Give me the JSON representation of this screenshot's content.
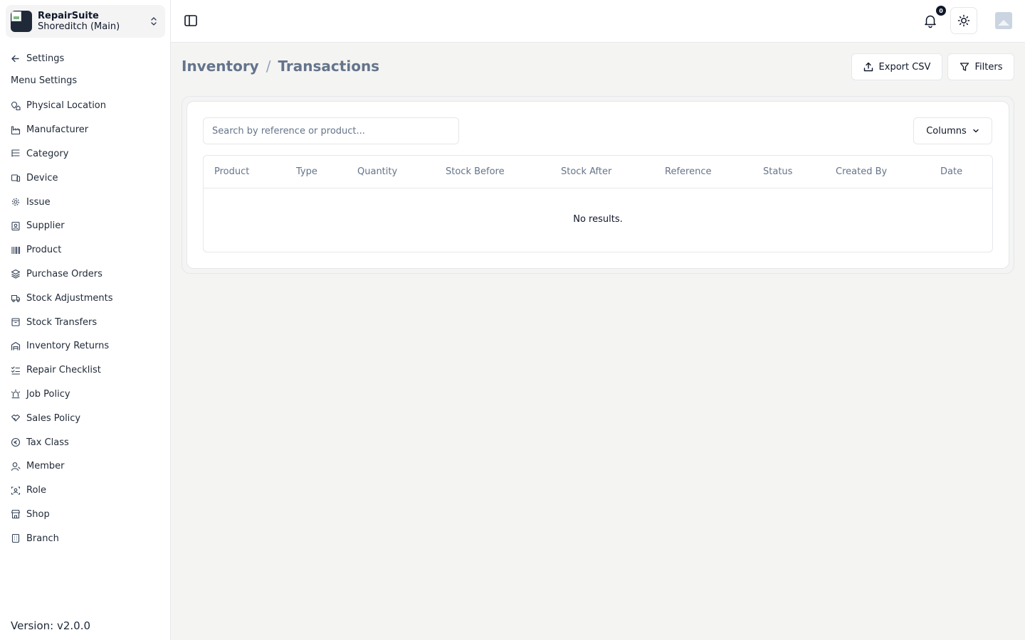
{
  "brand": {
    "name": "RepairSuite",
    "branch": "Shoreditch (Main)"
  },
  "sidebar": {
    "back_label": "Settings",
    "menu_heading": "Menu Settings",
    "items": [
      {
        "label": "Physical Location",
        "icon": "map-pin-house-icon"
      },
      {
        "label": "Manufacturer",
        "icon": "factory-icon"
      },
      {
        "label": "Category",
        "icon": "list-tree-icon"
      },
      {
        "label": "Device",
        "icon": "devices-icon"
      },
      {
        "label": "Issue",
        "icon": "cog-icon"
      },
      {
        "label": "Supplier",
        "icon": "contact-icon"
      },
      {
        "label": "Product",
        "icon": "barcode-icon"
      },
      {
        "label": "Purchase Orders",
        "icon": "layers-icon"
      },
      {
        "label": "Stock Adjustments",
        "icon": "truck-icon"
      },
      {
        "label": "Stock Transfers",
        "icon": "box-icon"
      },
      {
        "label": "Inventory Returns",
        "icon": "warehouse-icon"
      },
      {
        "label": "Repair Checklist",
        "icon": "list-checks-icon"
      },
      {
        "label": "Job Policy",
        "icon": "siren-icon"
      },
      {
        "label": "Sales Policy",
        "icon": "handshake-icon"
      },
      {
        "label": "Tax Class",
        "icon": "coin-icon"
      },
      {
        "label": "Member",
        "icon": "user-icon"
      },
      {
        "label": "Role",
        "icon": "user-scan-icon"
      },
      {
        "label": "Shop",
        "icon": "store-icon"
      },
      {
        "label": "Branch",
        "icon": "building-icon"
      }
    ],
    "version": "Version: v2.0.0"
  },
  "topbar": {
    "notification_count": "0"
  },
  "breadcrumb": {
    "parent": "Inventory",
    "separator": "/",
    "current": "Transactions"
  },
  "actions": {
    "export_label": "Export CSV",
    "filters_label": "Filters"
  },
  "search": {
    "placeholder": "Search by reference or product...",
    "value": ""
  },
  "columns_label": "Columns",
  "table": {
    "headers": [
      "Product",
      "Type",
      "Quantity",
      "Stock Before",
      "Stock After",
      "Reference",
      "Status",
      "Created By",
      "Date"
    ],
    "empty_text": "No results."
  }
}
